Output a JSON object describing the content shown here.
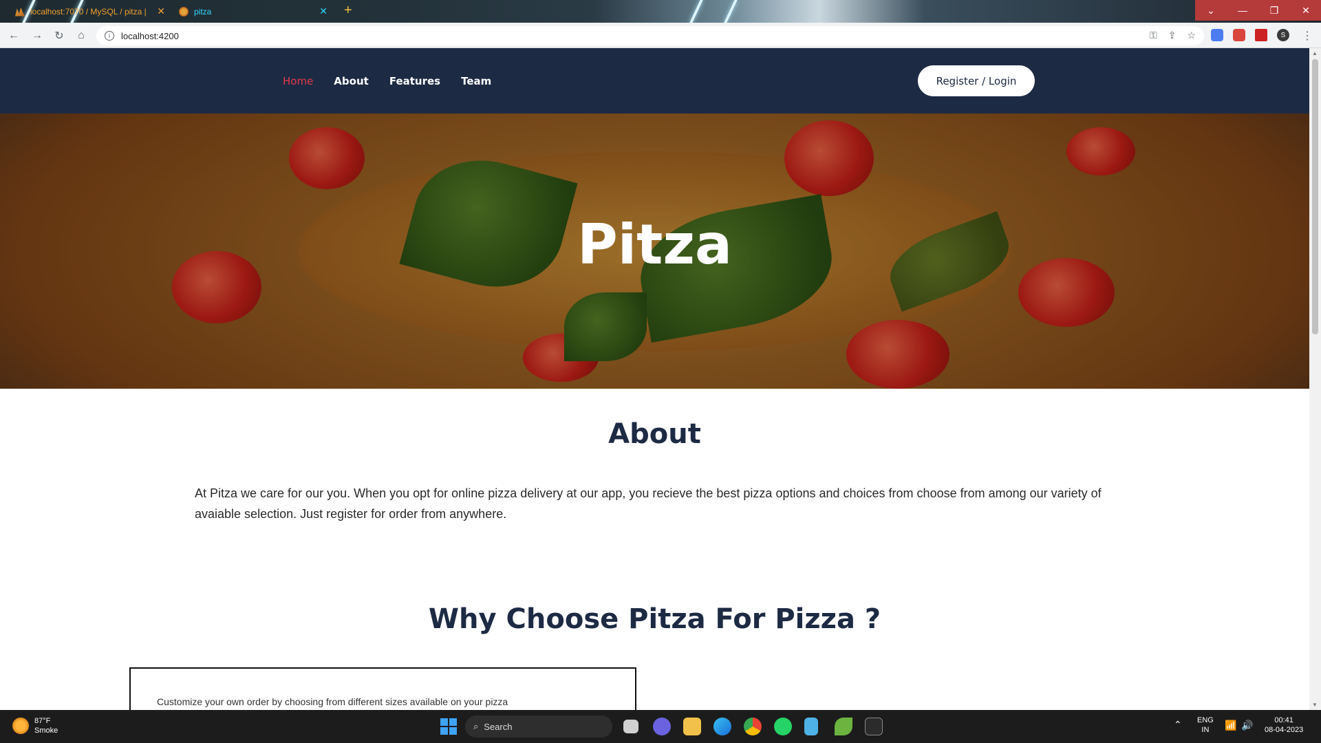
{
  "browser": {
    "tabs": [
      {
        "title": "localhost:7070 / MySQL / pitza |"
      },
      {
        "title": "pitza"
      }
    ],
    "url": "localhost:4200",
    "profile_initial": "S"
  },
  "site": {
    "nav": {
      "links": [
        "Home",
        "About",
        "Features",
        "Team"
      ],
      "active": "Home",
      "register_label": "Register / Login"
    },
    "hero": {
      "title": "Pitza"
    },
    "about": {
      "title": "About",
      "text": "At Pitza we care for our you. When you opt for online pizza delivery at our app, you recieve the best pizza options and choices from choose from among our variety of avaiable selection. Just register for order from anywhere."
    },
    "why": {
      "title": "Why Choose Pitza For Pizza ?",
      "card_text": "Customize your own order by choosing from different sizes available on your pizza"
    }
  },
  "taskbar": {
    "weather": {
      "temp": "87°F",
      "condition": "Smoke"
    },
    "search_label": "Search",
    "lang": "ENG",
    "region": "IN",
    "time": "00:41",
    "date": "08-04-2023"
  },
  "colors": {
    "nav_bg": "#1d2a44",
    "active_link": "#e8394a",
    "heading": "#1d2a44"
  }
}
